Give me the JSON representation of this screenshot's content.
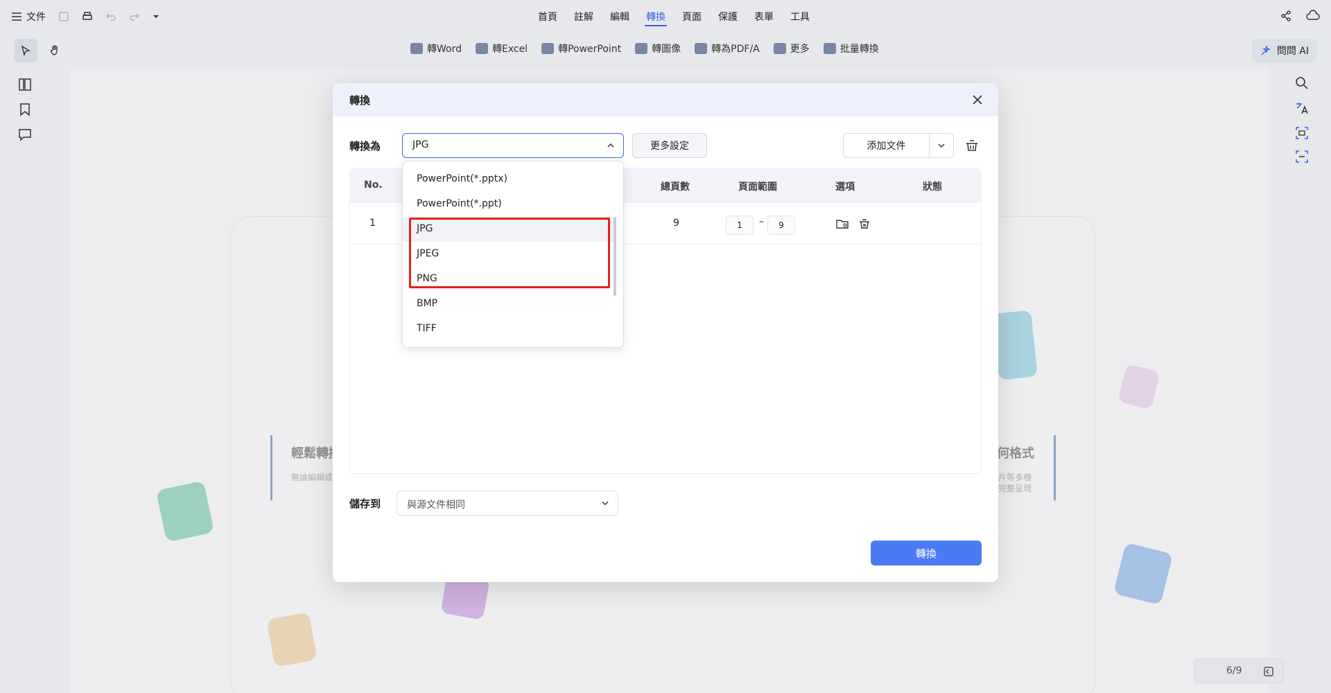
{
  "menubar": {
    "file_label": "文件",
    "tabs": [
      {
        "label": "首頁"
      },
      {
        "label": "註解"
      },
      {
        "label": "編輯"
      },
      {
        "label": "轉換"
      },
      {
        "label": "頁面"
      },
      {
        "label": "保護"
      },
      {
        "label": "表單"
      },
      {
        "label": "工具"
      }
    ],
    "active_tab": "轉換"
  },
  "toolbar": {
    "items": [
      {
        "label": "轉Word"
      },
      {
        "label": "轉Excel"
      },
      {
        "label": "轉PowerPoint"
      },
      {
        "label": "轉圖像"
      },
      {
        "label": "轉為PDF/A"
      },
      {
        "label": "更多"
      },
      {
        "label": "批量轉換"
      }
    ],
    "ai_label": "問問 AI"
  },
  "background": {
    "title_left": "輕鬆轉換",
    "sub_left": "無論編輯或",
    "title_right": "何格式",
    "sub_right_1": "片等多種",
    "sub_right_2": "完整呈現"
  },
  "page_counter": "6/9",
  "modal": {
    "title": "轉換",
    "convert_to_label": "轉換為",
    "selected_format": "JPG",
    "more_settings_label": "更多設定",
    "add_file_label": "添加文件",
    "table": {
      "headers": [
        "No.",
        "總頁數",
        "頁面範圍",
        "選項",
        "狀態"
      ],
      "rows": [
        {
          "no": "1",
          "total_pages": "9",
          "range_from": "1",
          "range_sep": "–",
          "range_to": "9"
        }
      ]
    },
    "save_to_label": "儲存到",
    "save_to_value": "與源文件相同",
    "convert_button": "轉換"
  },
  "dropdown": {
    "options": [
      {
        "label": "PowerPoint(*.pptx)"
      },
      {
        "label": "PowerPoint(*.ppt)"
      },
      {
        "label": "JPG"
      },
      {
        "label": "JPEG"
      },
      {
        "label": "PNG"
      },
      {
        "label": "BMP"
      },
      {
        "label": "TIFF"
      }
    ]
  },
  "colors": {
    "accent": "#3a67f0",
    "primary_button": "#4b7af5",
    "highlight_box": "#e32020"
  }
}
